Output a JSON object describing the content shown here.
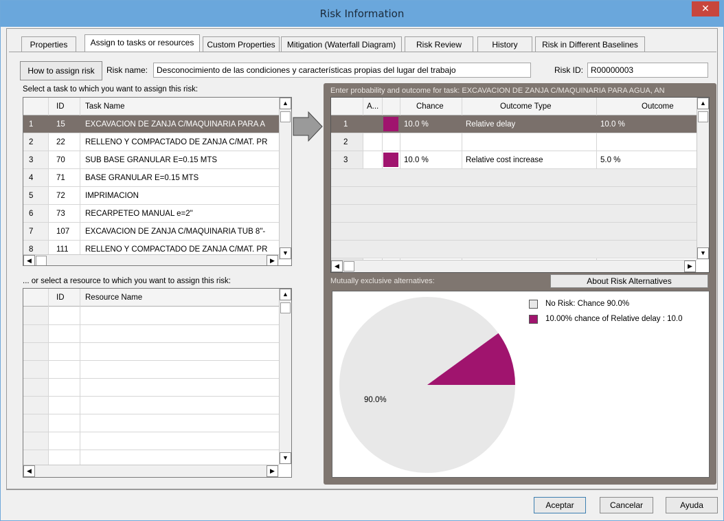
{
  "window": {
    "title": "Risk Information",
    "close_glyph": "✕"
  },
  "tabs": [
    {
      "label": "Properties"
    },
    {
      "label": "Assign to tasks or resources"
    },
    {
      "label": "Custom Properties"
    },
    {
      "label": "Mitigation (Waterfall Diagram)"
    },
    {
      "label": "Risk Review"
    },
    {
      "label": "History"
    },
    {
      "label": "Risk in Different Baselines"
    }
  ],
  "risk": {
    "how_to_label": "How to assign risk",
    "name_label": "Risk name:",
    "name_value": "Desconocimiento de las condiciones y características propias del lugar del trabajo",
    "id_label": "Risk ID:",
    "id_value": "R00000003"
  },
  "tasks": {
    "caption": "Select a task to which you want to assign this risk:",
    "headers": {
      "id": "ID",
      "name": "Task Name"
    },
    "rows": [
      {
        "num": "1",
        "id": "15",
        "name": "EXCAVACION DE ZANJA C/MAQUINARIA PARA A"
      },
      {
        "num": "2",
        "id": "22",
        "name": "RELLENO Y COMPACTADO DE ZANJA C/MAT. PR"
      },
      {
        "num": "3",
        "id": "70",
        "name": "SUB BASE GRANULAR E=0.15 MTS"
      },
      {
        "num": "4",
        "id": "71",
        "name": "BASE GRANULAR E=0.15 MTS"
      },
      {
        "num": "5",
        "id": "72",
        "name": "IMPRIMACIÓN"
      },
      {
        "num": "6",
        "id": "73",
        "name": "RECARPETEO MANUAL e=2\""
      },
      {
        "num": "7",
        "id": "107",
        "name": "EXCAVACION DE ZANJA C/MAQUINARIA TUB 8\"-"
      },
      {
        "num": "8",
        "id": "111",
        "name": "RELLENO Y COMPACTADO DE ZANJA C/MAT. PR"
      }
    ]
  },
  "resources": {
    "caption": "... or select a resource to which you want to assign this risk:",
    "headers": {
      "id": "ID",
      "name": "Resource Name"
    }
  },
  "outcomes": {
    "caption": "Enter probability and outcome for task: EXCAVACION DE ZANJA C/MAQUINARIA PARA AGUA, AN",
    "headers": {
      "a": "A...",
      "chance": "Chance",
      "type": "Outcome Type",
      "outcome": "Outcome"
    },
    "rows": [
      {
        "num": "1",
        "chance": "10.0 %",
        "type": "Relative delay",
        "outcome": "10.0 %",
        "color": "#a0146e"
      },
      {
        "num": "2",
        "chance": "",
        "type": "",
        "outcome": "",
        "color": ""
      },
      {
        "num": "3",
        "chance": "10.0 %",
        "type": "Relative cost increase",
        "outcome": "5.0 %",
        "color": "#a0146e"
      }
    ]
  },
  "alternatives": {
    "caption": "Mutually exclusive alternatives:",
    "about_label": "About Risk Alternatives",
    "legend": [
      {
        "label": "No Risk: Chance 90.0%",
        "color": "#e8e8e8"
      },
      {
        "label": "10.00% chance of Relative delay : 10.0",
        "color": "#a0146e"
      }
    ],
    "pie_label": "90.0%",
    "slice_fraction": 0.1
  },
  "footer": {
    "ok": "Aceptar",
    "cancel": "Cancelar",
    "help": "Ayuda"
  }
}
